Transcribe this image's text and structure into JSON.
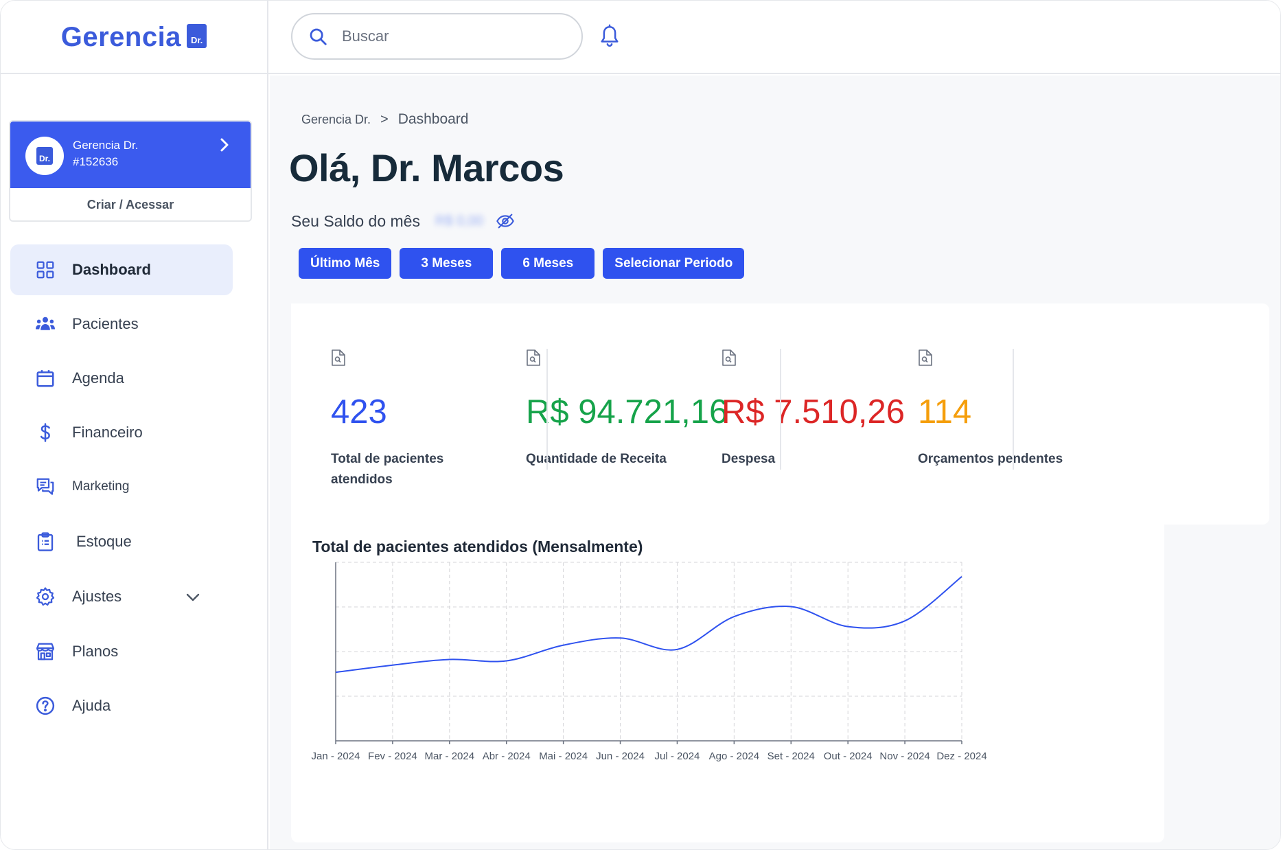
{
  "brand": {
    "name": "Gerencia",
    "badge": "Dr."
  },
  "search": {
    "placeholder": "Buscar"
  },
  "account": {
    "avatar": "Dr.",
    "name": "Gerencia Dr.",
    "id": "#152636",
    "action": "Criar / Acessar"
  },
  "sidebar": {
    "items": [
      {
        "label": "Dashboard",
        "icon": "grid-icon",
        "active": true
      },
      {
        "label": "Pacientes",
        "icon": "users-icon"
      },
      {
        "label": "Agenda",
        "icon": "calendar-icon"
      },
      {
        "label": "Financeiro",
        "icon": "dollar-icon"
      },
      {
        "label": "Marketing",
        "icon": "chat-icon"
      },
      {
        "label": "Estoque",
        "icon": "clipboard-icon"
      },
      {
        "label": "Ajustes",
        "icon": "gear-icon"
      },
      {
        "label": "Planos",
        "icon": "store-icon"
      },
      {
        "label": "Ajuda",
        "icon": "help-icon"
      }
    ]
  },
  "breadcrumb": {
    "root": "Gerencia Dr.",
    "separator": ">",
    "current": "Dashboard"
  },
  "greeting": "Olá, Dr. Marcos",
  "balance": {
    "label": "Seu Saldo do mês",
    "value": "R$ 0,00"
  },
  "periods": [
    "Último Mês",
    "3 Meses",
    "6 Meses",
    "Selecionar Periodo"
  ],
  "stats": [
    {
      "value": "423",
      "label": "Total de pacientes atendidos",
      "color": "#2f52ef"
    },
    {
      "value": "R$ 94.721,16",
      "label": "Quantidade de Receita",
      "color": "#16a34a"
    },
    {
      "value": "R$ 7.510,26",
      "label": "Despesa",
      "color": "#dc2626"
    },
    {
      "value": "114",
      "label": "Orçamentos pendentes",
      "color": "#f59e0b"
    }
  ],
  "colors": {
    "primary": "#2f52ef",
    "line": "#2f52ef"
  },
  "chart_data": {
    "type": "line",
    "title": "Total de pacientes atendidos (Mensalmente)",
    "categories": [
      "Jan - 2024",
      "Fev - 2024",
      "Mar - 2024",
      "Abr - 2024",
      "Mai - 2024",
      "Jun - 2024",
      "Jul - 2024",
      "Ago - 2024",
      "Set - 2024",
      "Out - 2024",
      "Nov - 2024",
      "Dez - 2024"
    ],
    "values": [
      23,
      28,
      32,
      31,
      42,
      47,
      39,
      62,
      69,
      55,
      59,
      90
    ],
    "ylim": [
      -25,
      100
    ],
    "grid": true,
    "legend": "none"
  }
}
